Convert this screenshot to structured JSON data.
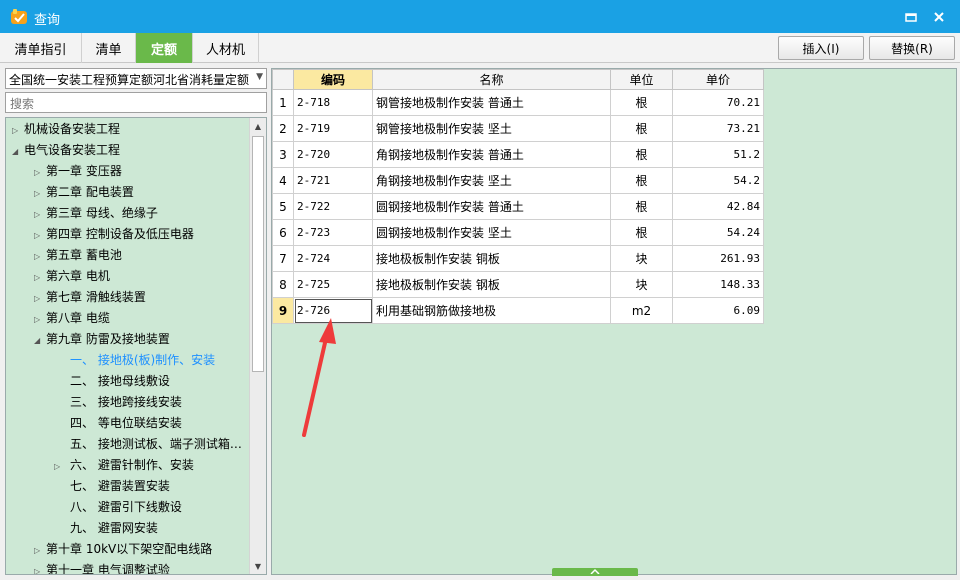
{
  "window": {
    "title": "查询",
    "minimize_icon": "minimize-icon",
    "close_icon": "close-icon"
  },
  "tabs": [
    {
      "label": "清单指引",
      "active": false
    },
    {
      "label": "清单",
      "active": false
    },
    {
      "label": "定额",
      "active": true
    },
    {
      "label": "人材机",
      "active": false
    }
  ],
  "toolbar": {
    "insert_label": "插入(I)",
    "replace_label": "替换(R)"
  },
  "library": {
    "selected": "全国统一安装工程预算定额河北省消耗量定额"
  },
  "search": {
    "placeholder": "搜索",
    "value": ""
  },
  "tree": [
    {
      "label": "机械设备安装工程",
      "expanded": false
    },
    {
      "label": "电气设备安装工程",
      "expanded": true
    },
    {
      "label": "第一章 变压器",
      "expanded": false
    },
    {
      "label": "第二章 配电装置",
      "expanded": false
    },
    {
      "label": "第三章 母线、绝缘子",
      "expanded": false
    },
    {
      "label": "第四章 控制设备及低压电器",
      "expanded": false
    },
    {
      "label": "第五章 蓄电池",
      "expanded": false
    },
    {
      "label": "第六章 电机",
      "expanded": false
    },
    {
      "label": "第七章 滑触线装置",
      "expanded": false
    },
    {
      "label": "第八章 电缆",
      "expanded": false
    },
    {
      "label": "第九章 防雷及接地装置",
      "expanded": true
    },
    {
      "label": "一、 接地极(板)制作、安装",
      "selected": true
    },
    {
      "label": "二、 接地母线敷设"
    },
    {
      "label": "三、 接地跨接线安装"
    },
    {
      "label": "四、 等电位联结安装"
    },
    {
      "label": "五、 接地测试板、端子测试箱…"
    },
    {
      "label": "六、 避雷针制作、安装",
      "expanded": false
    },
    {
      "label": "七、 避雷装置安装"
    },
    {
      "label": "八、 避雷引下线敷设"
    },
    {
      "label": "九、 避雷网安装"
    },
    {
      "label": "第十章 10kV以下架空配电线路",
      "expanded": false
    },
    {
      "label": "第十一章 电气调整试验",
      "expanded": false
    }
  ],
  "grid": {
    "columns": [
      "",
      "编码",
      "名称",
      "单位",
      "单价"
    ],
    "rows": [
      {
        "no": "1",
        "code": "2-718",
        "name": "钢管接地极制作安装 普通土",
        "unit": "根",
        "price": "70.21"
      },
      {
        "no": "2",
        "code": "2-719",
        "name": "钢管接地极制作安装 坚土",
        "unit": "根",
        "price": "73.21"
      },
      {
        "no": "3",
        "code": "2-720",
        "name": "角钢接地极制作安装 普通土",
        "unit": "根",
        "price": "51.2"
      },
      {
        "no": "4",
        "code": "2-721",
        "name": "角钢接地极制作安装 坚土",
        "unit": "根",
        "price": "54.2"
      },
      {
        "no": "5",
        "code": "2-722",
        "name": "圆钢接地极制作安装 普通土",
        "unit": "根",
        "price": "42.84"
      },
      {
        "no": "6",
        "code": "2-723",
        "name": "圆钢接地极制作安装 坚土",
        "unit": "根",
        "price": "54.24"
      },
      {
        "no": "7",
        "code": "2-724",
        "name": "接地极板制作安装 铜板",
        "unit": "块",
        "price": "261.93"
      },
      {
        "no": "8",
        "code": "2-725",
        "name": "接地极板制作安装 钢板",
        "unit": "块",
        "price": "148.33"
      },
      {
        "no": "9",
        "code": "2-726",
        "name": "利用基础钢筋做接地极",
        "unit": "m2",
        "price": "6.09",
        "current": true
      }
    ]
  },
  "colors": {
    "titlebar": "#1aa1e4",
    "active_tab": "#6ab94a",
    "pane_bg": "#cde8d5",
    "header_highlight": "#fbe9a1",
    "selected_tree_text": "#1e90ff",
    "annotation_arrow": "#ee3b3b"
  }
}
